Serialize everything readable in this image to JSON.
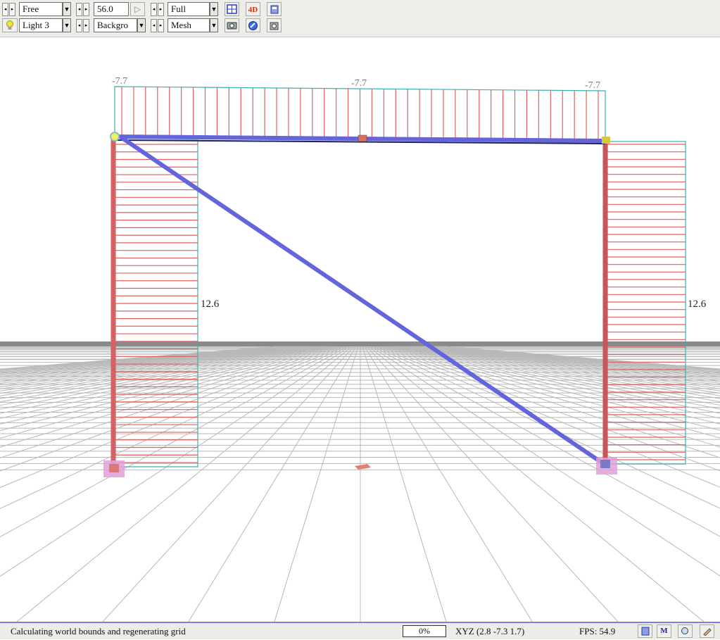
{
  "toolbar": {
    "view_mode": "Free",
    "fov": "56.0",
    "display_mode": "Full",
    "light": "Light 3",
    "background": "Backgro",
    "render_mode": "Mesh",
    "icons": {
      "play": "play-icon",
      "grid": "grid-view-icon",
      "view_4d": "4d-icon",
      "model": "model-icon",
      "light": "lightbulb-icon",
      "camera": "camera-icon",
      "render": "render-icon",
      "settings": "settings-icon"
    },
    "labels": {
      "view_4d": "4D"
    }
  },
  "viewport": {
    "labels": {
      "beam_left": "-7.7",
      "beam_mid": "-7.7",
      "beam_right": "-7.7",
      "col_left": "12.6",
      "col_right": "12.6"
    },
    "colors": {
      "diagram_line": "#e06060",
      "diagram_outline": "#3ab0b0",
      "member": "#6464dc",
      "column": "#d86060",
      "support": "#e0a0d8",
      "grid": "#b8b8b8",
      "horizon": "#8a8a8a"
    }
  },
  "statusbar": {
    "message": "Calculating world bounds and regenerating grid",
    "progress": "0%",
    "xyz": "XYZ (2.8 -7.3 1.7)",
    "fps": "FPS: 54.9",
    "m_label": "M"
  }
}
